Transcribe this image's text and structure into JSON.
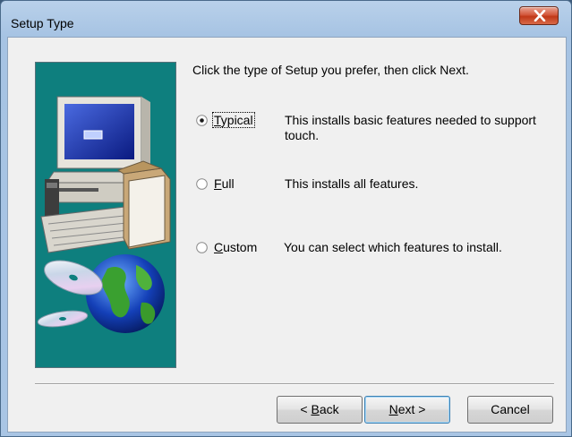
{
  "window": {
    "title": "Setup Type"
  },
  "prompt": "Click the type of Setup you prefer, then click Next.",
  "options": [
    {
      "label_prefix": "",
      "label_mnemonic": "T",
      "label_rest": "ypical",
      "description": "This installs basic features needed to support touch.",
      "selected": true
    },
    {
      "label_prefix": "",
      "label_mnemonic": "F",
      "label_rest": "ull",
      "description": "This installs all features.",
      "selected": false
    },
    {
      "label_prefix": "",
      "label_mnemonic": "C",
      "label_rest": "ustom",
      "description": "You can select which features to install.",
      "selected": false
    }
  ],
  "buttons": {
    "back": {
      "prefix": "< ",
      "mnemonic": "B",
      "rest": "ack"
    },
    "next": {
      "prefix": "",
      "mnemonic": "N",
      "rest": "ext >"
    },
    "cancel": {
      "label": "Cancel"
    }
  },
  "colors": {
    "art_background": "#0e7f7e",
    "close_button": "#c8462a"
  },
  "icons": {
    "close": "close-x-icon",
    "art": "computer-and-globe-illustration"
  }
}
